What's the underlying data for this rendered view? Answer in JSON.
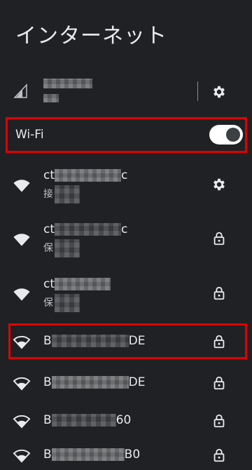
{
  "header": {
    "title": "インターネット"
  },
  "mobile": {
    "name_blurred": "",
    "status_blurred": ""
  },
  "wifi": {
    "label": "Wi-Fi",
    "enabled": true
  },
  "networks": [
    {
      "ssid_prefix": "ct",
      "ssid_suffix": "c",
      "status": "接",
      "trailing": "gear"
    },
    {
      "ssid_prefix": "ct",
      "ssid_suffix": "c",
      "status": "保",
      "trailing": "lock"
    },
    {
      "ssid_prefix": "ct",
      "ssid_suffix": "",
      "status": "保",
      "trailing": "lock"
    },
    {
      "ssid_prefix": "B",
      "ssid_suffix": "DE",
      "status": "",
      "trailing": "lock"
    },
    {
      "ssid_prefix": "B",
      "ssid_suffix": "DE",
      "status": "",
      "trailing": "lock"
    },
    {
      "ssid_prefix": "B",
      "ssid_suffix": "60",
      "status": "",
      "trailing": "lock"
    },
    {
      "ssid_prefix": "B",
      "ssid_suffix": "B0",
      "status": "",
      "trailing": "lock"
    }
  ]
}
